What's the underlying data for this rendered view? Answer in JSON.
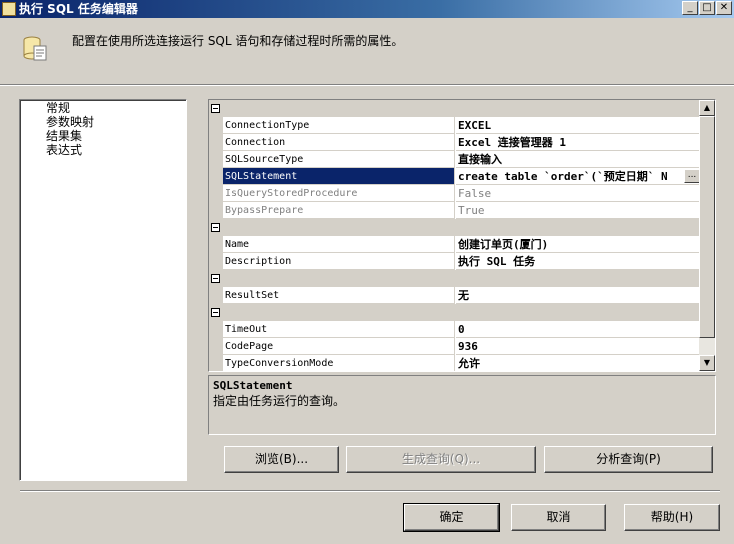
{
  "window": {
    "title": "执行 SQL 任务编辑器",
    "controls": {
      "minimize": "_",
      "maximize": "□",
      "close": "✕"
    }
  },
  "header": {
    "text": "配置在使用所选连接运行 SQL 语句和存储过程时所需的属性。",
    "icon": "sql-task-icon"
  },
  "nav": {
    "items": [
      {
        "label": "常规"
      },
      {
        "label": "参数映射"
      },
      {
        "label": "结果集"
      },
      {
        "label": "表达式"
      }
    ]
  },
  "grid": {
    "categories": [
      {
        "rows": [
          {
            "name": "ConnectionType",
            "value": "EXCEL"
          },
          {
            "name": "Connection",
            "value": "Excel 连接管理器 1"
          },
          {
            "name": "SQLSourceType",
            "value": "直接输入"
          },
          {
            "name": "SQLStatement",
            "value": "create table `order`(`预定日期` N",
            "selected": true,
            "button": "..."
          },
          {
            "name": "IsQueryStoredProcedure",
            "value": "False",
            "disabled": true
          },
          {
            "name": "BypassPrepare",
            "value": "True",
            "disabled": true
          }
        ]
      },
      {
        "rows": [
          {
            "name": "Name",
            "value": "创建订单页(厦门)"
          },
          {
            "name": "Description",
            "value": "执行 SQL 任务"
          }
        ]
      },
      {
        "rows": [
          {
            "name": "ResultSet",
            "value": "无"
          }
        ]
      },
      {
        "rows": [
          {
            "name": "TimeOut",
            "value": "0"
          },
          {
            "name": "CodePage",
            "value": "936"
          },
          {
            "name": "TypeConversionMode",
            "value": "允许"
          }
        ]
      }
    ]
  },
  "description": {
    "title": "SQLStatement",
    "text": "指定由任务运行的查询。"
  },
  "actions": {
    "browse": "浏览(B)...",
    "build_query": "生成查询(Q)...",
    "parse_query": "分析查询(P)"
  },
  "footer": {
    "ok": "确定",
    "cancel": "取消",
    "help": "帮助(H)"
  }
}
